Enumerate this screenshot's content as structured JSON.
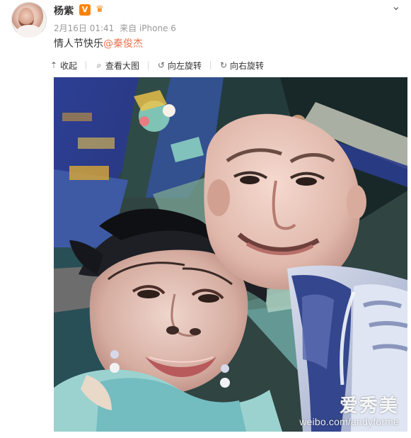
{
  "post": {
    "username": "杨紫",
    "vip_badge": "V",
    "meta": {
      "date": "2月16日 01:41",
      "via": "来自 iPhone 6"
    },
    "text_prefix": "情人节快乐",
    "mention": "@秦俊杰",
    "toolbar": {
      "collapse": "收起",
      "view_large": "查看大图",
      "rotate_left": "向左旋转",
      "rotate_right": "向右旋转"
    },
    "watermark": {
      "brand": "爱秀美",
      "url": "weibo.com/andyforme"
    }
  },
  "icons": {
    "dropdown": "chevron-down-icon",
    "collapse": "arrow-up-icon",
    "view_large": "search-icon",
    "rotate_left": "rotate-left-icon",
    "rotate_right": "rotate-right-icon",
    "vip": "vip-badge-icon",
    "crown": "crown-icon"
  },
  "colors": {
    "mention": "#eb7350",
    "vip": "#ff8200",
    "meta": "#999999",
    "text": "#333333"
  }
}
